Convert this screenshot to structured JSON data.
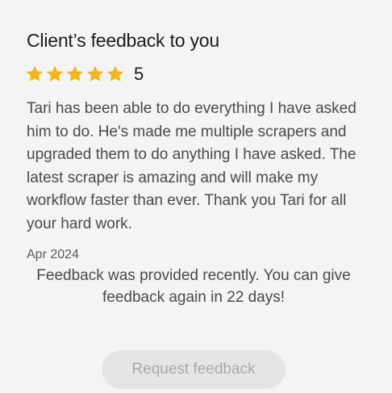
{
  "card": {
    "title": "Client’s feedback to you",
    "rating": {
      "value": "5",
      "stars": 5,
      "star_color": "#f0b81e"
    },
    "review_text": "Tari has been able to do everything I have asked him to do. He's made me multiple scrapers and upgraded them to do anything I have asked. The latest scraper is amazing and will make my workflow faster than ever. Thank you Tari for all your hard work.",
    "date": "Apr 2024",
    "notice": "Feedback was provided recently. You can give feedback again in 22 days!",
    "request_button": {
      "label": "Request feedback",
      "disabled": true
    }
  }
}
